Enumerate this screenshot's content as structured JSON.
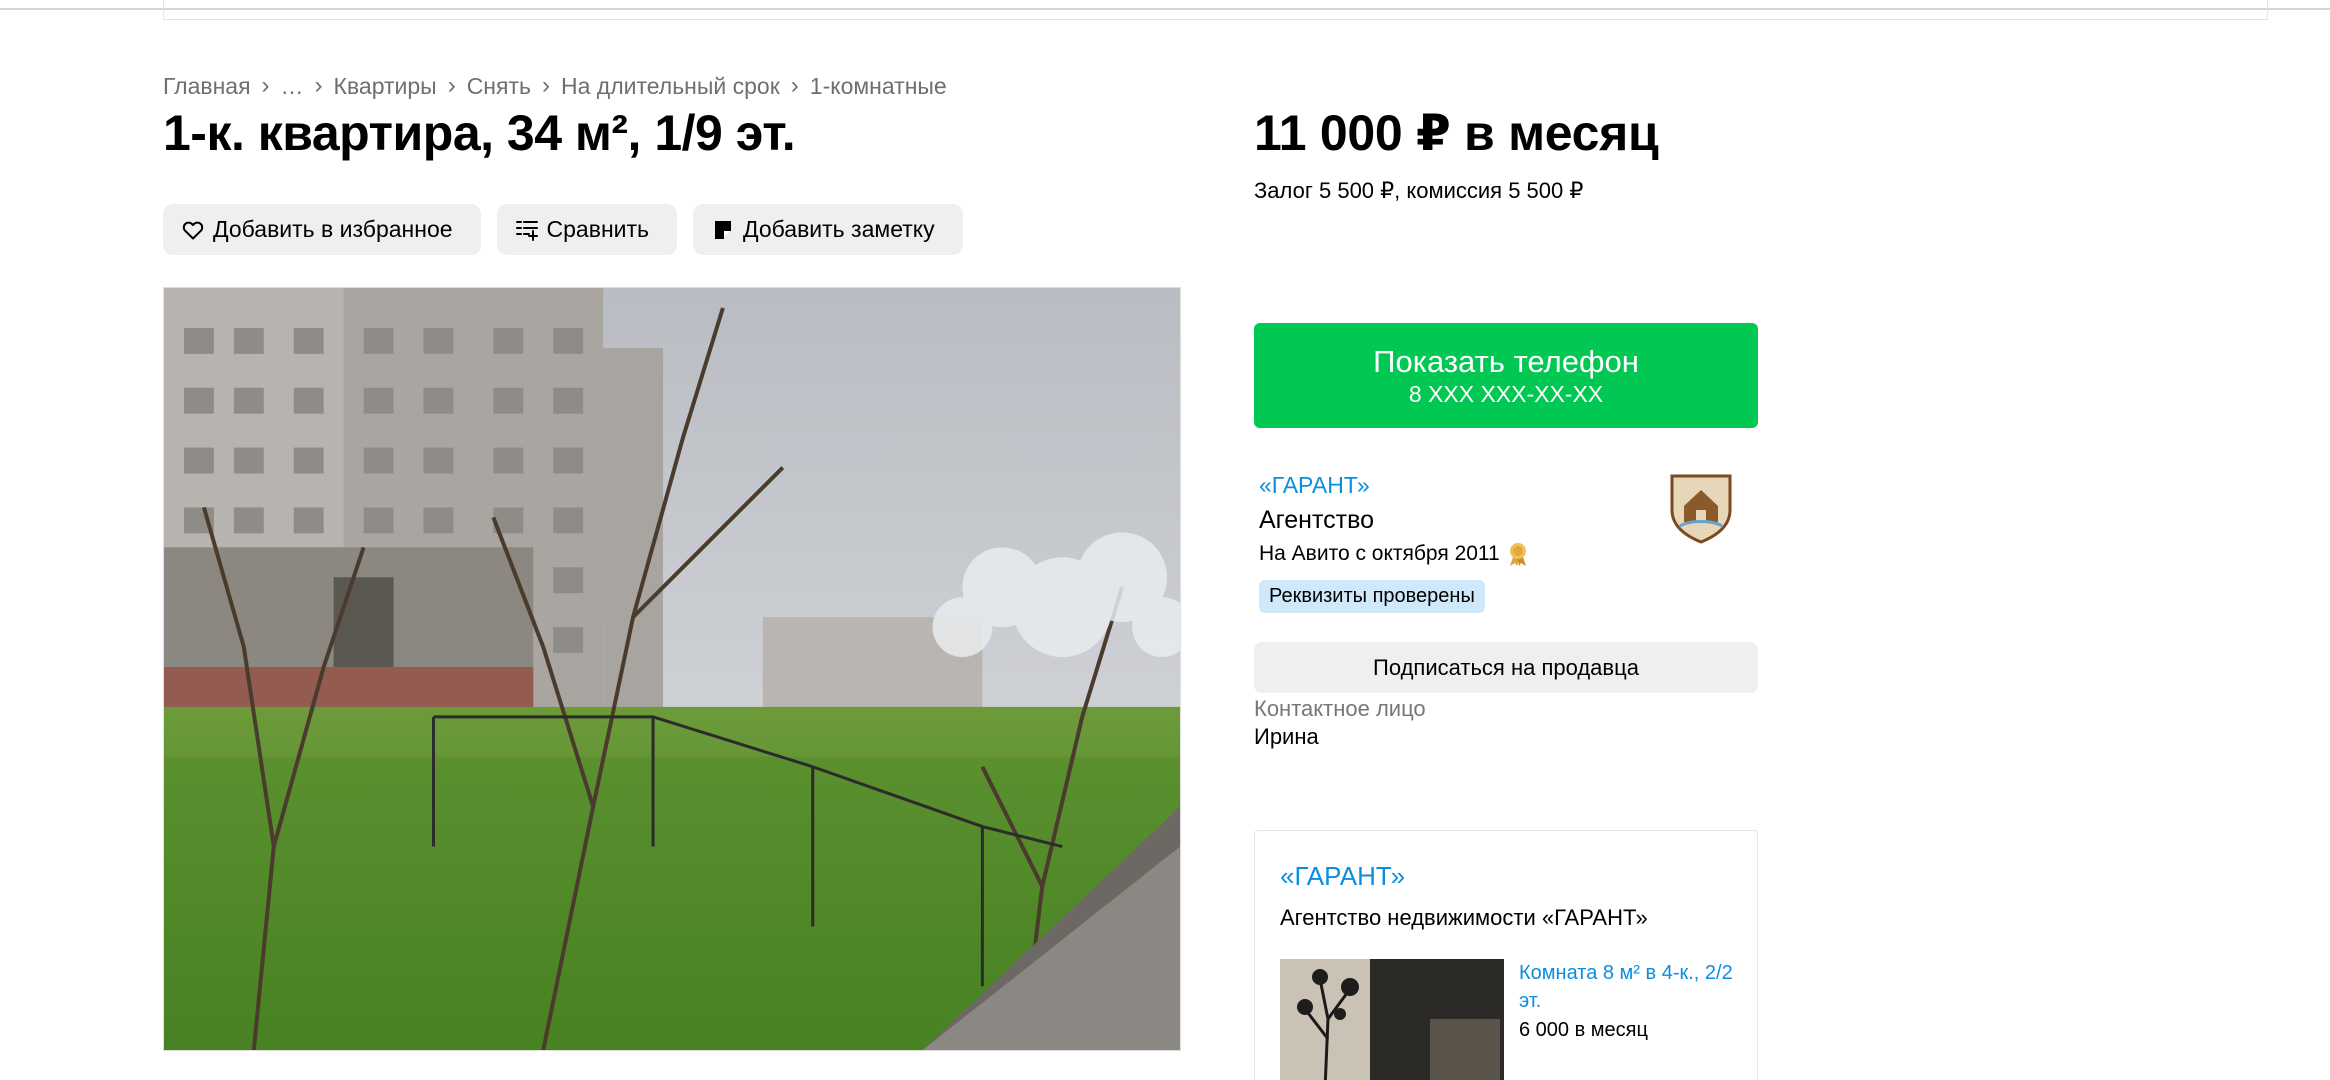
{
  "breadcrumb": {
    "items": [
      "Главная",
      "…",
      "Квартиры",
      "Снять",
      "На длительный срок",
      "1-комнатные"
    ],
    "separator": "›"
  },
  "listing": {
    "title": "1-к. квартира, 34 м², 1/9 эт.",
    "price": "11 000 ₽ в месяц",
    "deposit": "Залог 5 500 ₽, комиссия 5 500 ₽"
  },
  "actions": {
    "favorite_label": "Добавить в избранное",
    "compare_label": "Сравнить",
    "note_label": "Добавить заметку"
  },
  "phone_button": {
    "label": "Показать телефон",
    "number": "8 XXX XXX-XX-XX"
  },
  "seller": {
    "name": "«ГАРАНТ»",
    "type": "Агентство",
    "since": "На Авито с октября 2011",
    "verified_badge": "Реквизиты проверены",
    "subscribe_label": "Подписаться на продавца",
    "contact_label": "Контактное лицо",
    "contact_name": "Ирина"
  },
  "agency_card": {
    "name": "«ГАРАНТ»",
    "description": "Агентство недвижимости «ГАРАНТ»",
    "item_title": "Комната 8 м² в 4-к., 2/2 эт.",
    "item_price": "6 000 в месяц"
  },
  "icons": {
    "favorite": "heart-icon",
    "compare": "compare-icon",
    "note": "note-icon",
    "medal": "medal-icon"
  },
  "colors": {
    "accent_green": "#00c853",
    "link_blue": "#0a8ee0",
    "badge_blue": "#cfe9fb",
    "button_gray": "#efefef"
  }
}
